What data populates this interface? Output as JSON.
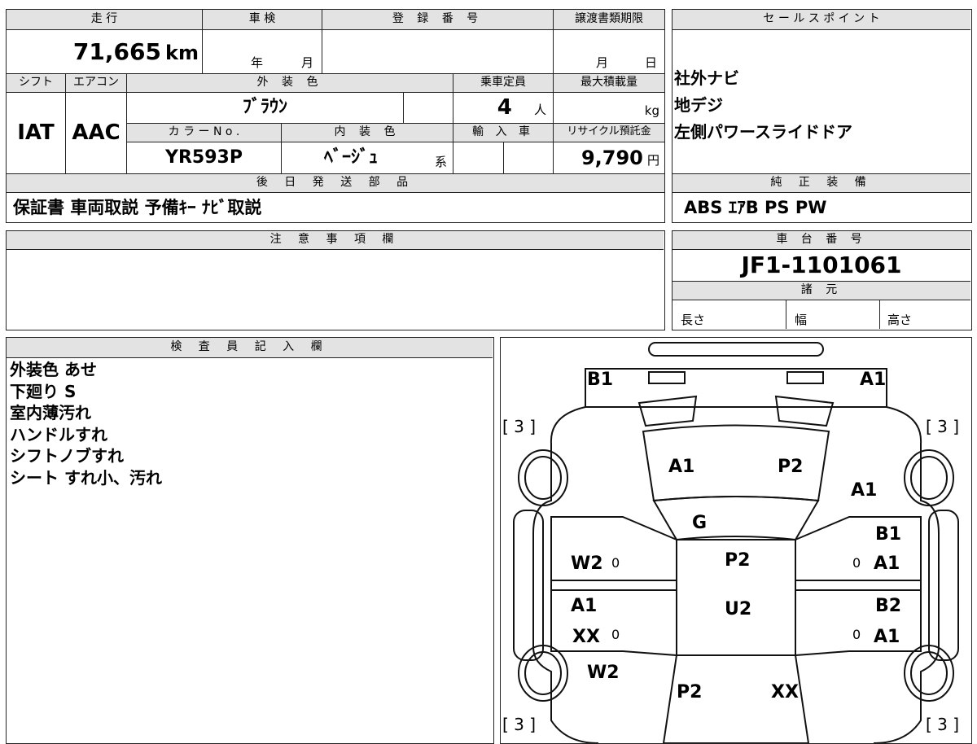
{
  "top_table": {
    "mileage_label": "走 行",
    "mileage_value": "71,665",
    "mileage_unit": "km",
    "inspection_label": "車 検",
    "inspection_year": "年",
    "inspection_month": "月",
    "registration_label": "登 録 番 号",
    "transfer_label": "譲渡書類期限",
    "transfer_month": "月",
    "transfer_day": "日",
    "shift_label": "シフト",
    "aircon_label": "エアコン",
    "ext_color_label": "外 装 色",
    "capacity_label": "乗車定員",
    "max_load_label": "最大積載量",
    "shift_value": "IAT",
    "aircon_value": "AAC",
    "ext_color_value": "ﾌﾞﾗｳﾝ",
    "capacity_value": "4",
    "capacity_unit": "人",
    "max_load_unit": "kg",
    "color_no_label": "カ ラ ー N o .",
    "int_color_label": "内 装 色",
    "import_label": "輸 入 車",
    "recycle_label": "リサイクル預託金",
    "color_no_value": "YR593P",
    "int_color_value": "ﾍﾞｰｼﾞｭ",
    "int_color_suffix": "系",
    "recycle_value": "9,790",
    "recycle_unit": "円",
    "later_parts_label": "後 日 発 送 部 品",
    "later_parts_value": "保証書 車両取説 予備ｷｰ ﾅﾋﾞ取説"
  },
  "sales_points": {
    "label": "セ ー ル ス ポ イ ン ト",
    "items": [
      "社外ナビ",
      "地デジ",
      "左側パワースライドドア"
    ]
  },
  "standard_equipment": {
    "label": "純 正 装 備",
    "value": "ABS ｴｱB PS PW"
  },
  "notes": {
    "label": "注 意 事 項 欄"
  },
  "chassis": {
    "label": "車 台 番 号",
    "value": "JF1-1101061"
  },
  "specs": {
    "label": "諸 元",
    "length": "長さ",
    "width": "幅",
    "height": "高さ"
  },
  "inspector": {
    "label": "検 査 員 記 入 欄",
    "lines": [
      "外装色 あせ",
      "下廻り S",
      "室内薄汚れ",
      "ハンドルすれ",
      "シフトノブすれ",
      "シート すれ小、汚れ"
    ]
  },
  "diagram": {
    "marks": {
      "front_left": "B1",
      "front_right": "A1",
      "tire_tl": "[ 3 ]",
      "tire_tr": "[ 3 ]",
      "tire_bl": "[ 3 ]",
      "tire_br": "[ 3 ]",
      "hood_left": "A1",
      "hood_right": "P2",
      "right_fender": "A1",
      "windshield": "G",
      "roof_front": "P2",
      "roof_back": "U2",
      "left_front_door": "W2",
      "left_rear_door_a": "A1",
      "left_rear_door_b": "XX",
      "left_quarter": "W2",
      "right_front_door_a": "B1",
      "right_front_door_b": "A1",
      "right_rear_door_a": "B2",
      "right_rear_door_b": "A1",
      "rear_left": "P2",
      "rear_right": "XX",
      "zero_1": "0",
      "zero_2": "0",
      "zero_3": "0",
      "zero_4": "0"
    }
  }
}
